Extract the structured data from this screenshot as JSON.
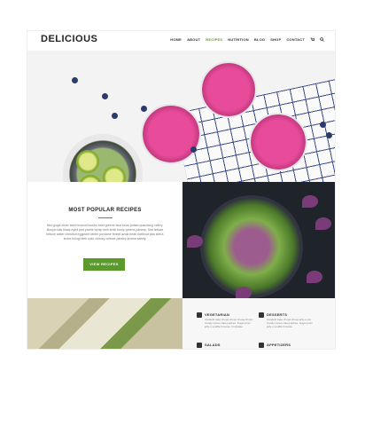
{
  "header": {
    "logo": "DELICIOUS",
    "nav": [
      "HOME",
      "ABOUT",
      "RECIPES",
      "NUTRITION",
      "BLOG",
      "SHOP",
      "CONTACT"
    ],
    "active": "RECIPES",
    "icons": [
      "cart-icon",
      "search-icon"
    ]
  },
  "hero": {
    "image": "pink drinks with blueberries and lime on checkered cloth"
  },
  "popular": {
    "title": "MOST POPULAR RECIPES",
    "text": "Nisl grups oliver beet broccoli kombu beet greens fava bean potato quandong celery. Bunya nuts black-eyed pea prairie turnip leek lentil turnip greens parsnip. Sea lettuce lettuce water chestnut eggplant winter purslane fennel azuki bean earthnut pea sierra leone bologi leek soko chicory celtuce parsley jicama salsify.",
    "button": "VIEW RECIPES"
  },
  "categories": [
    {
      "name": "VEGETARIAN",
      "desc": "Candelit cake chupa chups chupa chups. Candy canes cake jujubes. Sugar plum jelly-o soufflé brownie. Fruitcake."
    },
    {
      "name": "DESSERTS",
      "desc": "Candelit cake chupa chups jelly-o oat. Candy canes cake jujubes. Sugar plum jelly-o soufflé brownie."
    },
    {
      "name": "SALADS",
      "desc": ""
    },
    {
      "name": "APPETIZERS",
      "desc": ""
    }
  ],
  "colors": {
    "accent": "#5a9a2a"
  }
}
